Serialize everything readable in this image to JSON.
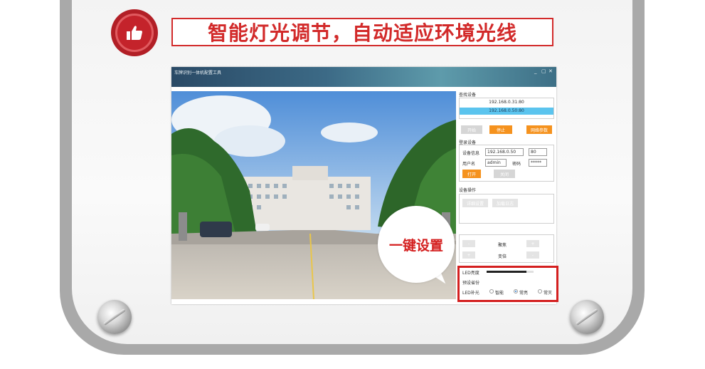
{
  "heading": {
    "title": "智能灯光调节，自动适应环境光线",
    "icon": "thumbs-up-icon",
    "accent": "#d22a2a"
  },
  "window": {
    "title": "车牌识别一体机配置工具",
    "controls": [
      "_",
      "▢",
      "✕"
    ]
  },
  "panel": {
    "find": {
      "section_label": "查找设备",
      "devices": [
        "192.168.0.31:80",
        "192.168.0.50:80"
      ],
      "selected_index": 1,
      "buttons": {
        "start": "开始",
        "stop": "停止",
        "network": "网络参数"
      }
    },
    "login": {
      "section_label": "登录设备",
      "device_info_label": "设备信息",
      "ip_value": "192.168.0.50",
      "port_value": "80",
      "username_label": "用户名",
      "username_value": "admin",
      "password_label": "密码",
      "password_value": "*****",
      "open_button": "打开",
      "close_button": "关闭"
    },
    "ops": {
      "section_label": "设备操作",
      "buttons": [
        "详细设置",
        "加载日志"
      ]
    },
    "ptz": {
      "rows": [
        {
          "minus": "-",
          "label": "聚焦",
          "plus": "+"
        },
        {
          "minus": "+",
          "label": "变倍",
          "plus": "-"
        }
      ]
    },
    "led": {
      "brightness_label": "LED亮度",
      "brightness_level": 0.85,
      "preset_label": "预设省份",
      "mode_label": "LED补光",
      "modes": [
        "智能",
        "常亮",
        "常灭"
      ],
      "selected_mode": 1
    }
  },
  "callout": {
    "text": "一键设置",
    "color": "#d41f1f"
  }
}
